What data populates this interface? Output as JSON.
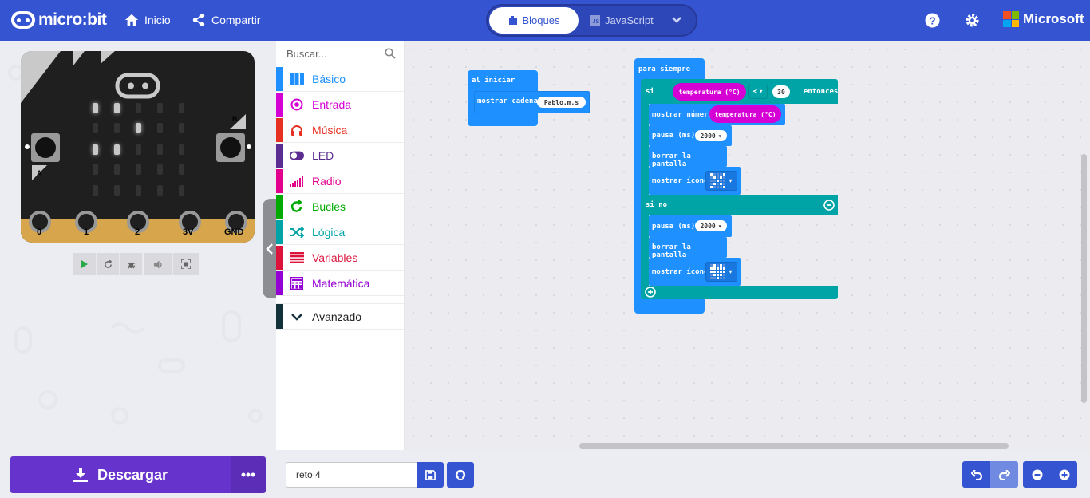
{
  "header": {
    "logo_text": "micro:bit",
    "home_label": "Inicio",
    "share_label": "Compartir",
    "tabs": {
      "blocks": "Bloques",
      "javascript": "JavaScript"
    },
    "brand": "Microsoft"
  },
  "simulator": {
    "pins": [
      "0",
      "1",
      "2",
      "3V",
      "GND"
    ],
    "button_a": "A",
    "button_b": "B"
  },
  "toolbox": {
    "search_placeholder": "Buscar...",
    "categories": [
      {
        "label": "Básico",
        "color": "#1e90ff",
        "icon": "grid-icon"
      },
      {
        "label": "Entrada",
        "color": "#d400d4",
        "icon": "target-icon"
      },
      {
        "label": "Música",
        "color": "#e63022",
        "icon": "headphones-icon"
      },
      {
        "label": "LED",
        "color": "#5c2d91",
        "icon": "toggle-icon"
      },
      {
        "label": "Radio",
        "color": "#e3008c",
        "icon": "signal-icon"
      },
      {
        "label": "Bucles",
        "color": "#00aa00",
        "icon": "refresh-icon"
      },
      {
        "label": "Lógica",
        "color": "#00a4a6",
        "icon": "shuffle-icon"
      },
      {
        "label": "Variables",
        "color": "#dc143c",
        "icon": "list-icon"
      },
      {
        "label": "Matemática",
        "color": "#9400d3",
        "icon": "calculator-icon"
      }
    ],
    "advanced": "Avanzado"
  },
  "workspace": {
    "on_start": {
      "label": "al iniciar",
      "show_string": "mostrar cadena",
      "string_value": "Pablo.m.s"
    },
    "forever": {
      "label": "para siempre",
      "if_label": "si",
      "temperature": "temperatura (°C)",
      "operator": "<",
      "threshold": "30",
      "then_label": "entonces",
      "show_number": "mostrar número",
      "pause": "pausa (ms)",
      "pause_value": "2000",
      "clear_screen": "borrar la pantalla",
      "show_icon": "mostrar ícono",
      "else_label": "si no"
    }
  },
  "bottom": {
    "download_label": "Descargar",
    "project_name": "reto 4"
  }
}
